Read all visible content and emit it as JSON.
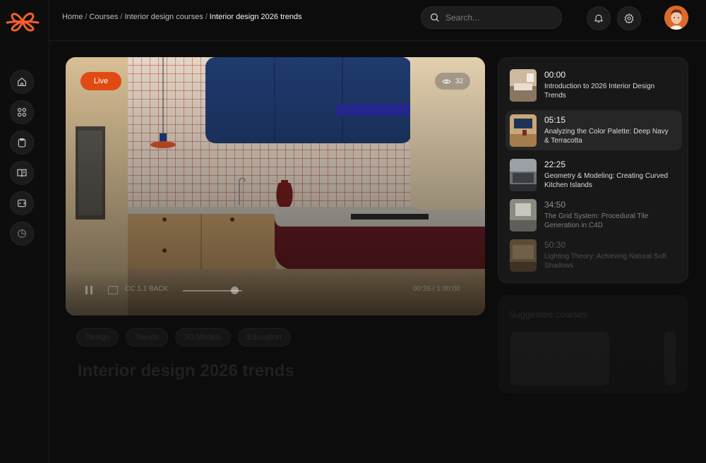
{
  "colors": {
    "accent": "#e24a14",
    "brand": "#f25f2a"
  },
  "sidebar": {
    "items": [
      {
        "icon": "home-icon"
      },
      {
        "icon": "grid-icon"
      },
      {
        "icon": "clipboard-icon"
      },
      {
        "icon": "book-icon"
      },
      {
        "icon": "video-icon"
      },
      {
        "icon": "pie-chart-icon"
      }
    ]
  },
  "header": {
    "breadcrumb": [
      "Home",
      "Courses",
      "Interior design courses",
      "Interior design 2026 trends"
    ],
    "search_placeholder": "Search...",
    "notification_icon": "bell-icon",
    "settings_icon": "gear-icon"
  },
  "video": {
    "live_label": "Live",
    "views_count": "32",
    "subtitle_label": "CC 1.1 BACK",
    "time_label": "00:26 / 1:00:00",
    "progress": 0.88
  },
  "playlist": {
    "chapters": [
      {
        "time": "00:00",
        "title": "Introduction to 2026 Interior Design Trends"
      },
      {
        "time": "05:15",
        "title": "Analyzing the Color Palette: Deep Navy & Terracotta"
      },
      {
        "time": "22:25",
        "title": "Geometry & Modeling: Creating Curved Kitchen Islands"
      },
      {
        "time": "34:50",
        "title": "The Grid System: Procedural Tile Generation in C4D"
      },
      {
        "time": "50:30",
        "title": "Lighting Theory: Achieving Natural Soft Shadows"
      }
    ]
  },
  "tags": [
    "Design",
    "Trends",
    "3D Models",
    "Education"
  ],
  "course_title": "Interior design 2026 trends",
  "suggested": {
    "title": "Suggested courses"
  }
}
